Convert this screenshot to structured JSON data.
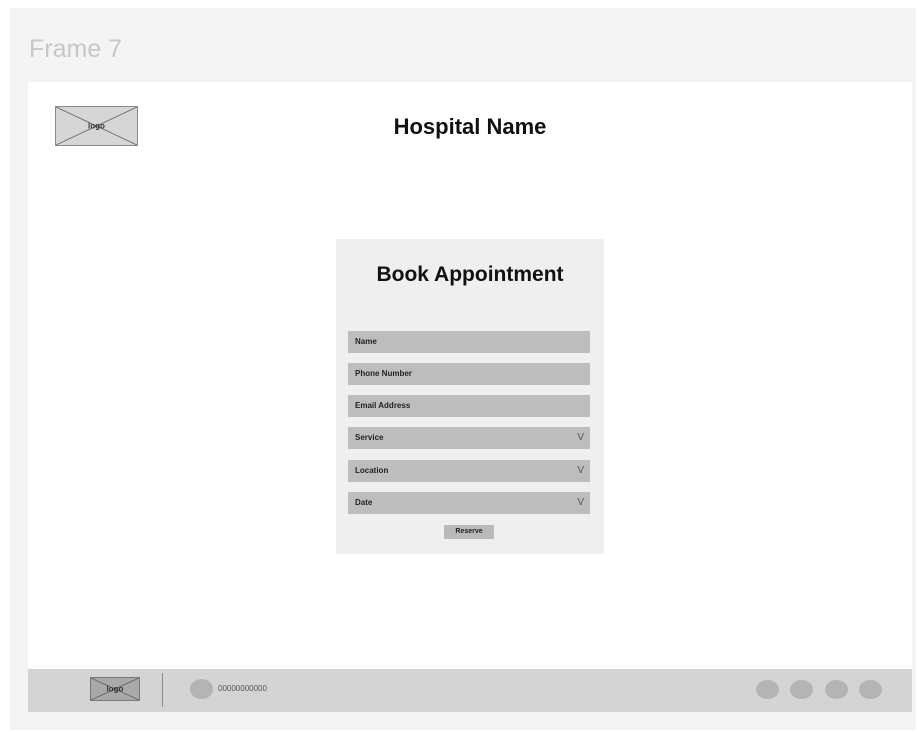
{
  "canvas": {
    "frame_label": "Frame 7"
  },
  "header": {
    "logo_text": "logo",
    "title": "Hospital Name"
  },
  "form": {
    "title": "Book Appointment",
    "fields": [
      {
        "label": "Name"
      },
      {
        "label": "Phone Number"
      },
      {
        "label": "Email Address"
      },
      {
        "label": "Service"
      },
      {
        "label": "Location"
      },
      {
        "label": "Date"
      }
    ],
    "dropdown_indicator": "V",
    "reserve_label": "Reserve"
  },
  "footer": {
    "logo_text": "logo",
    "phone_icon": "phone-icon",
    "phone_number": "00000000000",
    "social_icons": [
      "social-icon-1",
      "social-icon-2",
      "social-icon-3",
      "social-icon-4"
    ]
  },
  "colors": {
    "canvas_bg": "#f4f4f4",
    "frame_bg": "#ffffff",
    "card_bg": "#efefef",
    "field_bg": "#bdbdbd",
    "footer_bg": "#d4d4d4"
  }
}
